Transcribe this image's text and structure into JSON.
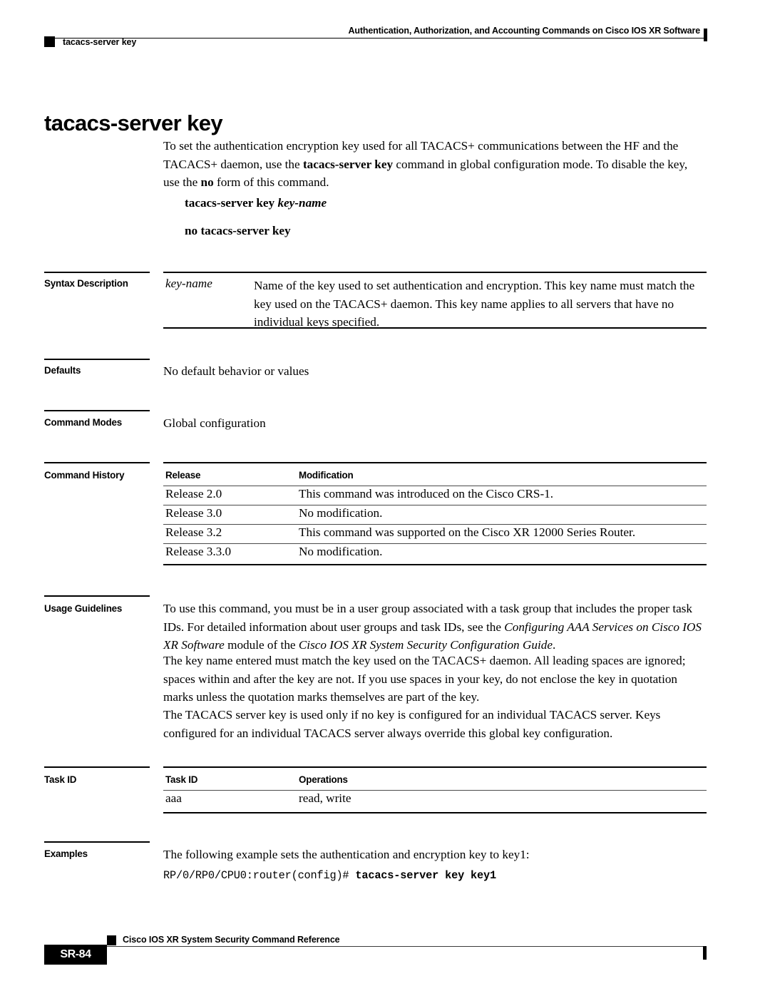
{
  "running_header": {
    "chapter_title": "Authentication, Authorization, and Accounting Commands on Cisco IOS XR Software",
    "command_name": "tacacs-server key"
  },
  "page_title": "tacacs-server key",
  "intro": {
    "part1": "To set the authentication encryption key used for all TACACS+ communications between the HF and the TACACS+ daemon, use the ",
    "bold1": "tacacs-server key",
    "part2": " command in global configuration mode. To disable the key, use the ",
    "bold2": "no",
    "part3": " form of this command."
  },
  "syntax": {
    "positive_command": "tacacs-server key ",
    "positive_argument": "key-name",
    "negative_command": "no tacacs-server key"
  },
  "sections": {
    "syntax_description": {
      "label": "Syntax Description",
      "argument": "key-name",
      "description": "Name of the key used to set authentication and encryption. This key name must match the key used on the TACACS+ daemon. This key name applies to all servers that have no individual keys specified."
    },
    "defaults": {
      "label": "Defaults",
      "text": "No default behavior or values"
    },
    "command_modes": {
      "label": "Command Modes",
      "text": "Global configuration"
    },
    "command_history": {
      "label": "Command History",
      "columns": [
        "Release",
        "Modification"
      ],
      "rows": [
        [
          "Release 2.0",
          "This command was introduced on the Cisco CRS-1."
        ],
        [
          "Release 3.0",
          "No modification."
        ],
        [
          "Release 3.2",
          "This command was supported on the Cisco XR 12000 Series Router."
        ],
        [
          "Release 3.3.0",
          "No modification."
        ]
      ]
    },
    "usage_guidelines": {
      "label": "Usage Guidelines",
      "para1_a": "To use this command, you must be in a user group associated with a task group that includes the proper task IDs. For detailed information about user groups and task IDs, see the ",
      "para1_italic1": "Configuring AAA Services on Cisco IOS XR Software",
      "para1_b": " module of the ",
      "para1_italic2": "Cisco IOS XR System Security Configuration Guide",
      "para1_c": ".",
      "para2": "The key name entered must match the key used on the TACACS+ daemon. All leading spaces are ignored; spaces within and after the key are not. If you use spaces in your key, do not enclose the key in quotation marks unless the quotation marks themselves are part of the key.",
      "para3": "The TACACS server key is used only if no key is configured for an individual TACACS server. Keys configured for an individual TACACS server always override this global key configuration."
    },
    "task_id": {
      "label": "Task ID",
      "columns": [
        "Task ID",
        "Operations"
      ],
      "rows": [
        [
          "aaa",
          "read, write"
        ]
      ]
    },
    "examples": {
      "label": "Examples",
      "intro": "The following example sets the authentication and encryption key to key1:",
      "code_prompt": "RP/0/RP0/CPU0:router(config)# ",
      "code_command": "tacacs-server key key1"
    }
  },
  "footer": {
    "page_number": "SR-84",
    "book_title": "Cisco IOS XR System Security Command Reference"
  },
  "icons": {
    "header_bullet": "black-square-bullet",
    "footer_bullet": "black-square-bullet"
  }
}
